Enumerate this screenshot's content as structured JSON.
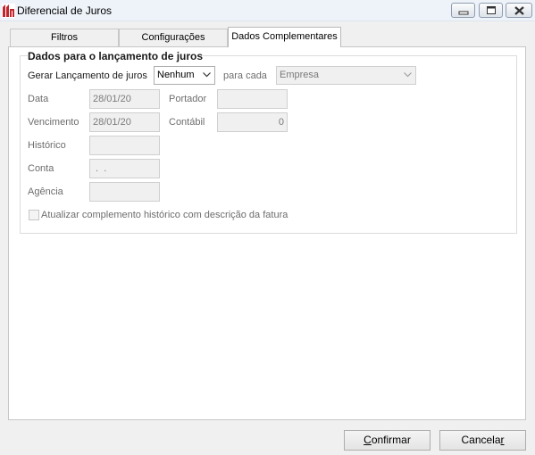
{
  "window": {
    "title": "Diferencial de Juros",
    "minimize_icon": "minimize-icon",
    "maximize_icon": "maximize-icon",
    "close_icon": "close-icon"
  },
  "tabs": [
    {
      "label": "Filtros",
      "active": false
    },
    {
      "label": "Configurações",
      "active": false
    },
    {
      "label": "Dados Complementares",
      "active": true
    }
  ],
  "group": {
    "title": "Dados para o lançamento de juros",
    "gerar_label": "Gerar Lançamento de juros",
    "gerar_value": "Nenhum",
    "para_cada_label": "para cada",
    "para_cada_value": "Empresa",
    "data_label": "Data",
    "data_value": "28/01/20",
    "portador_label": "Portador",
    "portador_value": "",
    "vencimento_label": "Vencimento",
    "vencimento_value": "28/01/20",
    "contabil_label": "Contábil",
    "contabil_value": "0",
    "historico_label": "Histórico",
    "historico_value": "",
    "conta_label": "Conta",
    "conta_value": " .  .",
    "agencia_label": "Agência",
    "agencia_value": "",
    "checkbox_label": "Atualizar complemento histórico com descrição da fatura",
    "checkbox_checked": false
  },
  "buttons": {
    "confirm_first": "C",
    "confirm_rest": "onfirmar",
    "cancel_pre": "Cancela",
    "cancel_ul": "r"
  }
}
